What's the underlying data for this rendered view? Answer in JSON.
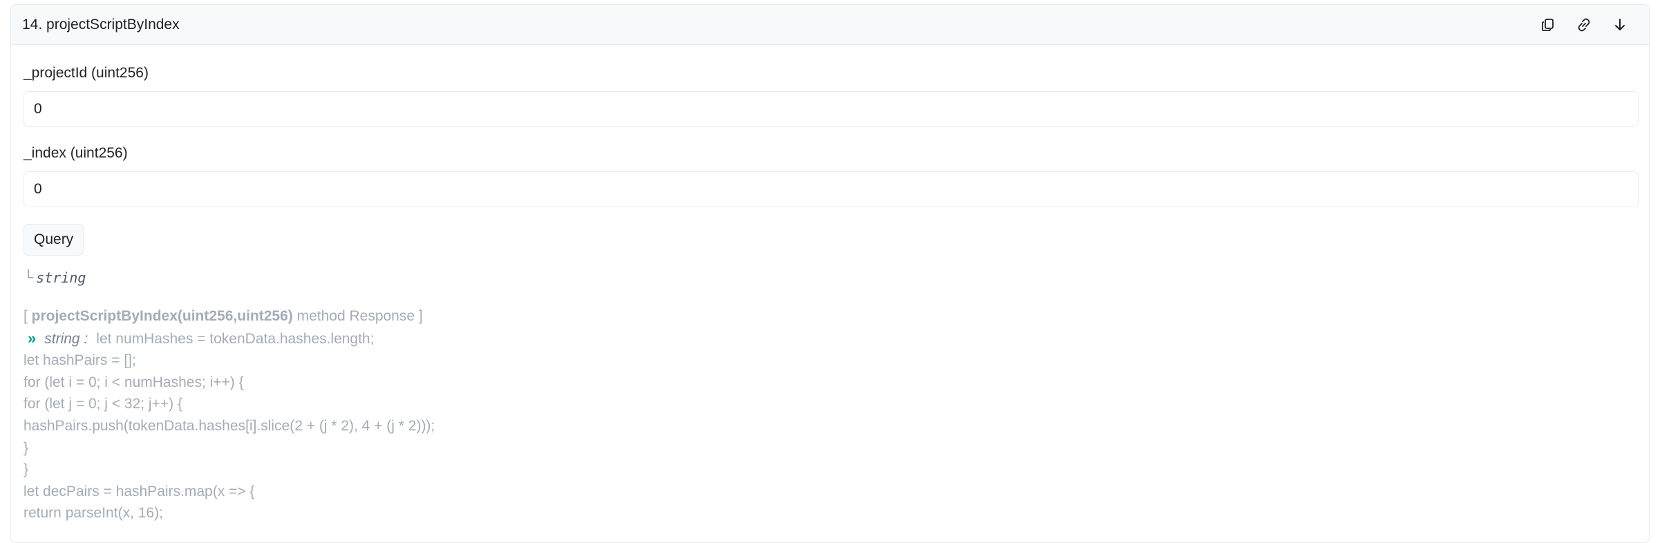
{
  "method": {
    "title": "14. projectScriptByIndex"
  },
  "icons": {
    "copy": "copy-icon",
    "link": "link-icon",
    "expand": "arrow-down-icon"
  },
  "inputs": [
    {
      "label": "_projectId (uint256)",
      "value": "0"
    },
    {
      "label": "_index (uint256)",
      "value": "0"
    }
  ],
  "query_button": "Query",
  "return_type": {
    "corner": "└",
    "type": "string"
  },
  "response": {
    "open_bracket": "[ ",
    "signature": "projectScriptByIndex(uint256,uint256)",
    "suffix": " method Response ]",
    "chevron": "»",
    "value_type": "string :",
    "lines": [
      "let numHashes = tokenData.hashes.length;",
      "let hashPairs = [];",
      "for (let i = 0; i < numHashes; i++) {",
      "for (let j = 0; j < 32; j++) {",
      "hashPairs.push(tokenData.hashes[i].slice(2 + (j * 2), 4 + (j * 2)));",
      "}",
      "}",
      "let decPairs = hashPairs.map(x => {",
      "return parseInt(x, 16);"
    ]
  }
}
